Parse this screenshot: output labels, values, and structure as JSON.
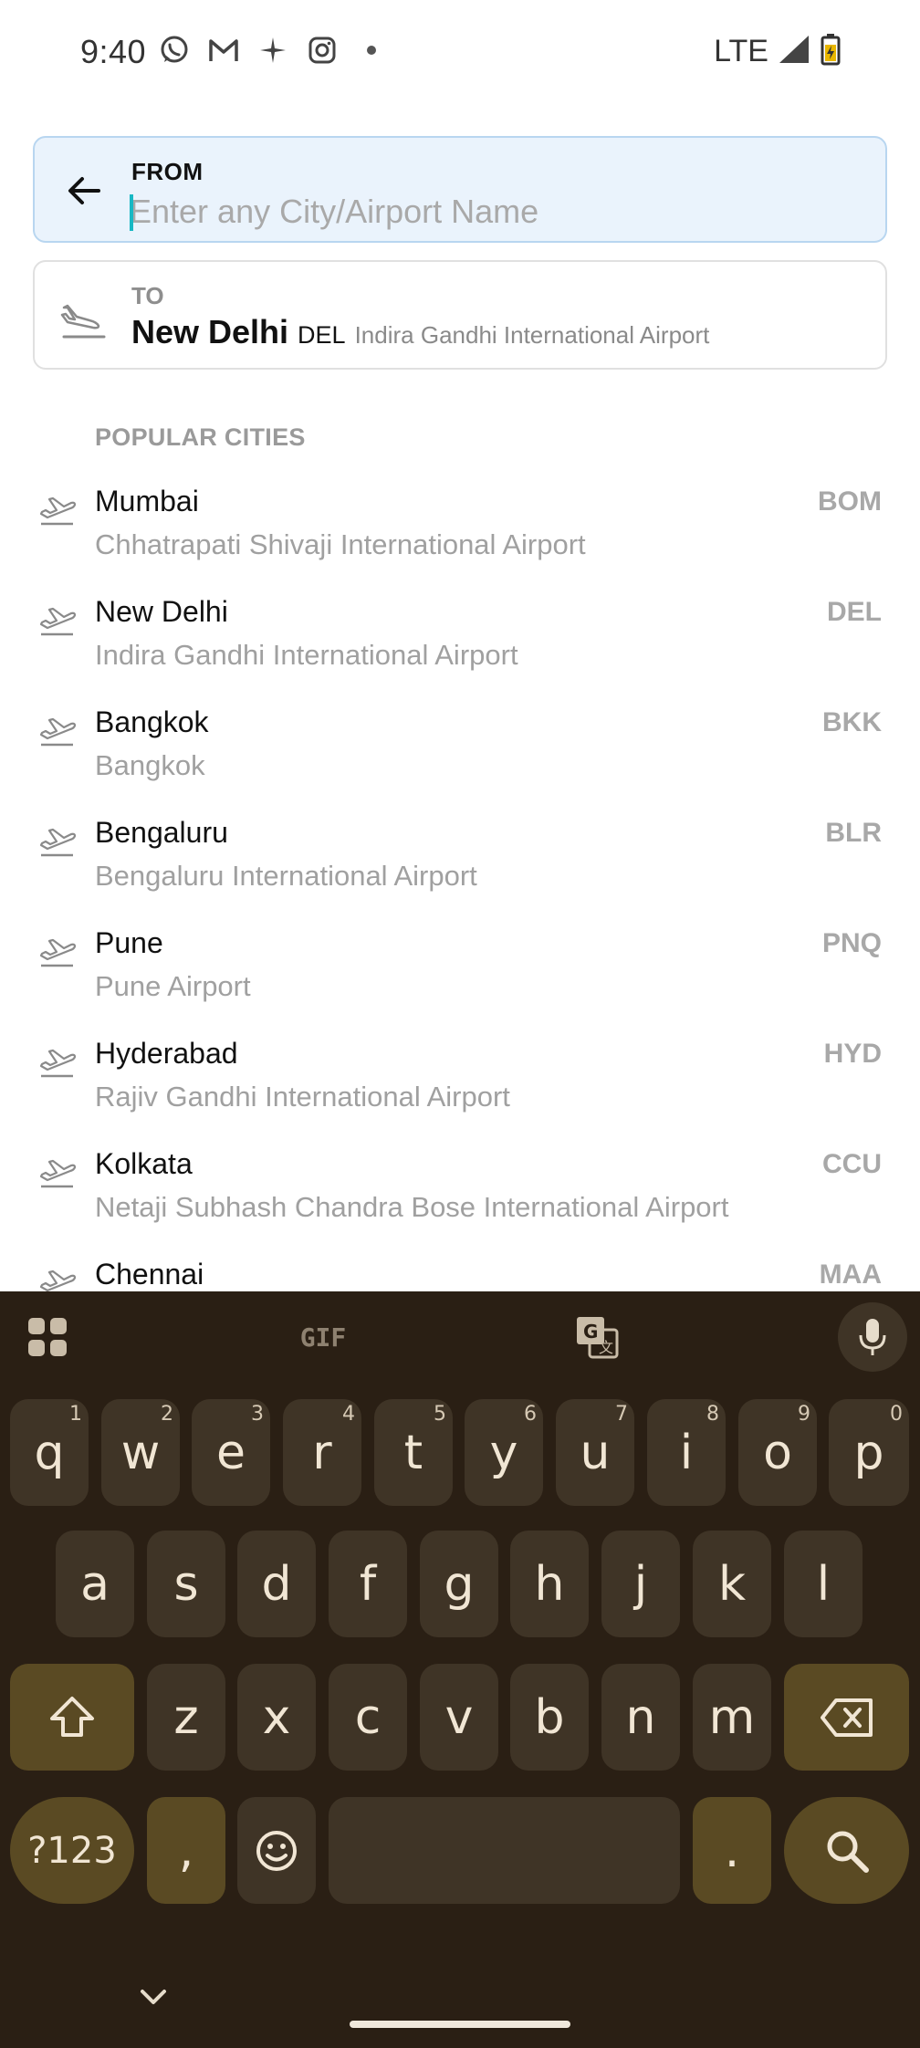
{
  "status_bar": {
    "time": "9:40",
    "network": "LTE",
    "app_icons": [
      "whatsapp-icon",
      "gmail-icon",
      "pinwheel-icon",
      "instagram-icon",
      "dot-icon"
    ]
  },
  "search": {
    "from_label": "FROM",
    "from_placeholder": "Enter any City/Airport Name",
    "from_value": "",
    "to_label": "TO",
    "to_city": "New Delhi",
    "to_code": "DEL",
    "to_airport": "Indira Gandhi International Airport"
  },
  "popular": {
    "title": "POPULAR CITIES",
    "cities": [
      {
        "name": "Mumbai",
        "airport": "Chhatrapati Shivaji International Airport",
        "code": "BOM"
      },
      {
        "name": "New Delhi",
        "airport": "Indira Gandhi International Airport",
        "code": "DEL"
      },
      {
        "name": "Bangkok",
        "airport": "Bangkok",
        "code": "BKK"
      },
      {
        "name": "Bengaluru",
        "airport": "Bengaluru International Airport",
        "code": "BLR"
      },
      {
        "name": "Pune",
        "airport": "Pune Airport",
        "code": "PNQ"
      },
      {
        "name": "Hyderabad",
        "airport": "Rajiv Gandhi International Airport",
        "code": "HYD"
      },
      {
        "name": "Kolkata",
        "airport": "Netaji Subhash Chandra Bose International Airport",
        "code": "CCU"
      },
      {
        "name": "Chennai",
        "airport": "",
        "code": "MAA"
      }
    ]
  },
  "keyboard": {
    "toolbar": {
      "gif_label": "GIF"
    },
    "row1": [
      {
        "key": "q",
        "hint": "1"
      },
      {
        "key": "w",
        "hint": "2"
      },
      {
        "key": "e",
        "hint": "3"
      },
      {
        "key": "r",
        "hint": "4"
      },
      {
        "key": "t",
        "hint": "5"
      },
      {
        "key": "y",
        "hint": "6"
      },
      {
        "key": "u",
        "hint": "7"
      },
      {
        "key": "i",
        "hint": "8"
      },
      {
        "key": "o",
        "hint": "9"
      },
      {
        "key": "p",
        "hint": "0"
      }
    ],
    "row2": [
      "a",
      "s",
      "d",
      "f",
      "g",
      "h",
      "j",
      "k",
      "l"
    ],
    "row3": [
      "z",
      "x",
      "c",
      "v",
      "b",
      "n",
      "m"
    ],
    "symbols_label": "?123",
    "comma": ",",
    "period": "."
  },
  "colors": {
    "from_bg": "#eaf3fc",
    "keyboard_bg": "#2a1f14",
    "key_bg": "#3f3426",
    "key_accent": "#5a4a23",
    "caret": "#18b8c4"
  }
}
